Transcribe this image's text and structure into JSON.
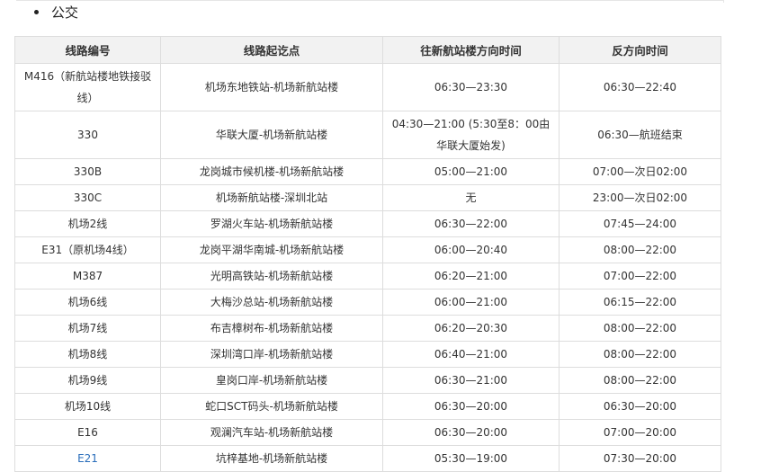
{
  "section": {
    "title": "公交"
  },
  "table": {
    "headers": [
      "线路编号",
      "线路起讫点",
      "往新航站楼方向时间",
      "反方向时间"
    ],
    "rows": [
      {
        "line": "M416（新航站楼地铁接驳线）",
        "route": "机场东地铁站-机场新航站楼",
        "to_terminal": "06:30—23:30",
        "reverse": "06:30—22:40",
        "tall": true
      },
      {
        "line": "330",
        "route": "华联大厦-机场新航站楼",
        "to_terminal": "04:30—21:00 (5:30至8：00由华联大厦始发)",
        "reverse": "06:30—航班结束",
        "tall": true
      },
      {
        "line": "330B",
        "route": "龙岗城市候机楼-机场新航站楼",
        "to_terminal": "05:00—21:00",
        "reverse": "07:00—次日02:00"
      },
      {
        "line": "330C",
        "route": "机场新航站楼-深圳北站",
        "to_terminal": "无",
        "reverse": "23:00—次日02:00"
      },
      {
        "line": "机场2线",
        "route": "罗湖火车站-机场新航站楼",
        "to_terminal": "06:30—22:00",
        "reverse": "07:45—24:00"
      },
      {
        "line": "E31（原机场4线）",
        "route": "龙岗平湖华南城-机场新航站楼",
        "to_terminal": "06:00—20:40",
        "reverse": "08:00—22:00"
      },
      {
        "line": "M387",
        "route": "光明高铁站-机场新航站楼",
        "to_terminal": "06:20—21:00",
        "reverse": "07:00—22:00"
      },
      {
        "line": "机场6线",
        "route": "大梅沙总站-机场新航站楼",
        "to_terminal": "06:00—21:00",
        "reverse": "06:15—22:00"
      },
      {
        "line": "机场7线",
        "route": "布吉樟树布-机场新航站楼",
        "to_terminal": "06:20—20:30",
        "reverse": "08:00—22:00"
      },
      {
        "line": "机场8线",
        "route": "深圳湾口岸-机场新航站楼",
        "to_terminal": "06:40—21:00",
        "reverse": "08:00—22:00"
      },
      {
        "line": "机场9线",
        "route": "皇岗口岸-机场新航站楼",
        "to_terminal": "06:30—21:00",
        "reverse": "08:00—22:00"
      },
      {
        "line": "机场10线",
        "route": "蛇口SCT码头-机场新航站楼",
        "to_terminal": "06:30—20:00",
        "reverse": "06:30—20:00"
      },
      {
        "line": "E16",
        "route": "观澜汽车站-机场新航站楼",
        "to_terminal": "06:30—20:00",
        "reverse": "07:00—20:00"
      },
      {
        "line": "E21",
        "route": "坑梓基地-机场新航站楼",
        "to_terminal": "05:30—19:00",
        "reverse": "07:30—20:00",
        "link": true
      }
    ]
  }
}
